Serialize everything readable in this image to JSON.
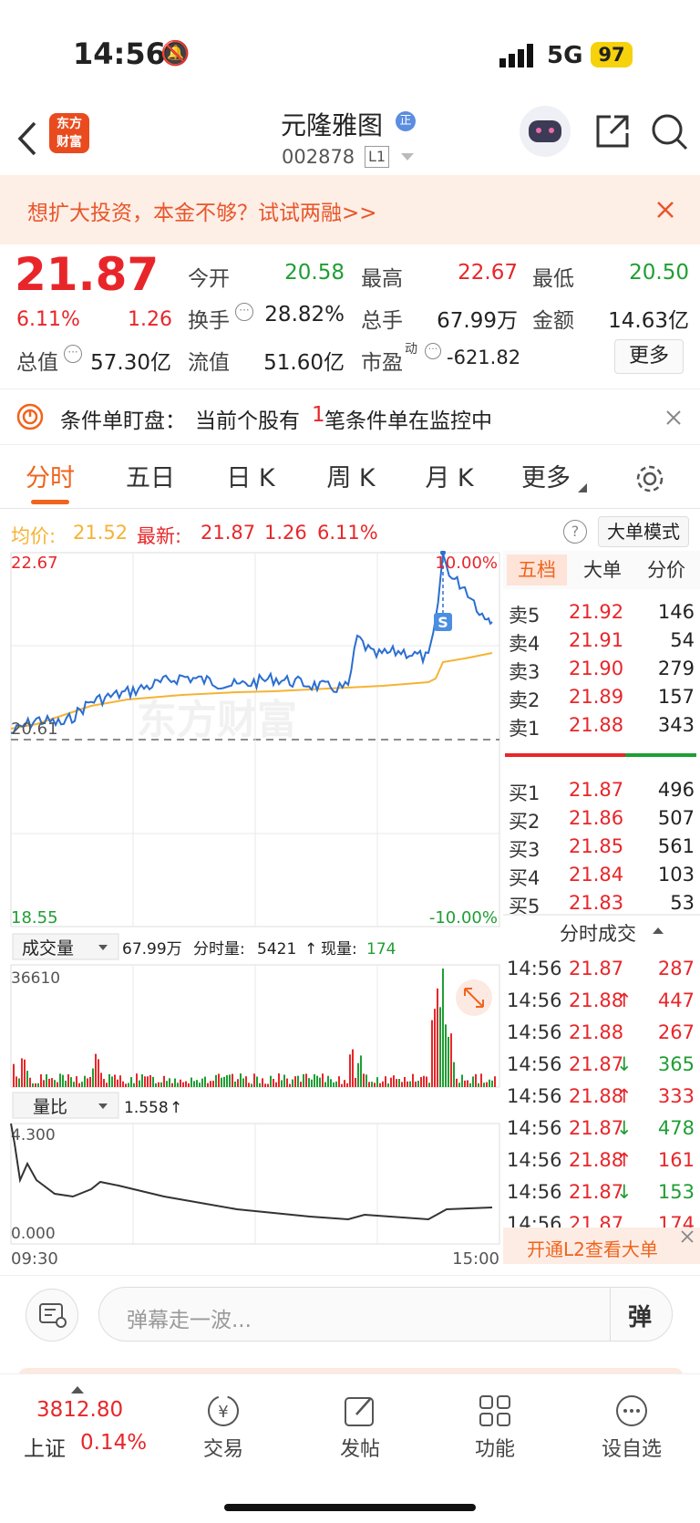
{
  "status": {
    "time": "14:56",
    "network": "5G",
    "battery": "97"
  },
  "nav": {
    "logo_line1": "东方",
    "logo_line2": "财富",
    "stock_name": "元隆雅图",
    "badge": "正",
    "code": "002878",
    "level": "L1"
  },
  "banner": {
    "text": "想扩大投资，本金不够？试试两融>>"
  },
  "quote": {
    "price": "21.87",
    "pct": "6.11%",
    "chg": "1.26",
    "open_label": "今开",
    "open": "20.58",
    "high_label": "最高",
    "high": "22.67",
    "low_label": "最低",
    "low": "20.50",
    "turnover_label": "换手",
    "turnover": "28.82%",
    "vol_label": "总手",
    "vol": "67.99万",
    "amount_label": "金额",
    "amount": "14.63亿",
    "mcap_label": "总值",
    "mcap": "57.30亿",
    "float_label": "流值",
    "float": "51.60亿",
    "pe_label": "市盈",
    "pe_sup": "动",
    "pe": "-621.82",
    "more": "更多"
  },
  "cond": {
    "label": "条件单盯盘：",
    "text_pre": "当前个股有",
    "count": "1",
    "text_post": "笔条件单在监控中"
  },
  "tabs": [
    "分时",
    "五日",
    "日 K",
    "周 K",
    "月 K",
    "更多"
  ],
  "avgline": {
    "avg_label": "均价:",
    "avg": "21.52",
    "latest_label": "最新:",
    "latest": "21.87",
    "chg": "1.26",
    "pct": "6.11%",
    "mode_btn": "大单模式"
  },
  "chart": {
    "y_top": "22.67",
    "y_mid": "20.61",
    "y_bot": "18.55",
    "pct_top": "10.00%",
    "pct_bot": "-10.00%",
    "watermark": "东方财富",
    "s_marker": "S",
    "vol_selector": "成交量",
    "vol_total": "67.99万",
    "vol_seg_label": "分时量:",
    "vol_seg": "5421",
    "vol_now_label": "现量:",
    "vol_now": "174",
    "vol_max": "36610",
    "ratio_selector": "量比",
    "ratio_value": "1.558",
    "ratio_max": "4.300",
    "ratio_min": "0.000",
    "t_start": "09:30",
    "t_end": "15:00"
  },
  "book": {
    "tabs": [
      "五档",
      "大单",
      "分价"
    ],
    "asks": [
      {
        "label": "卖5",
        "price": "21.92",
        "vol": "146"
      },
      {
        "label": "卖4",
        "price": "21.91",
        "vol": "54"
      },
      {
        "label": "卖3",
        "price": "21.90",
        "vol": "279"
      },
      {
        "label": "卖2",
        "price": "21.89",
        "vol": "157"
      },
      {
        "label": "卖1",
        "price": "21.88",
        "vol": "343"
      }
    ],
    "bids": [
      {
        "label": "买1",
        "price": "21.87",
        "vol": "496"
      },
      {
        "label": "买2",
        "price": "21.86",
        "vol": "507"
      },
      {
        "label": "买3",
        "price": "21.85",
        "vol": "561"
      },
      {
        "label": "买4",
        "price": "21.84",
        "vol": "103"
      },
      {
        "label": "买5",
        "price": "21.83",
        "vol": "53"
      }
    ],
    "trades_title": "分时成交",
    "trades": [
      {
        "time": "14:56",
        "price": "21.87",
        "arrow": "",
        "vol": "287"
      },
      {
        "time": "14:56",
        "price": "21.88",
        "arrow": "↑",
        "vol": "447"
      },
      {
        "time": "14:56",
        "price": "21.88",
        "arrow": "",
        "vol": "267"
      },
      {
        "time": "14:56",
        "price": "21.87",
        "arrow": "↓",
        "vol": "365"
      },
      {
        "time": "14:56",
        "price": "21.88",
        "arrow": "↑",
        "vol": "333"
      },
      {
        "time": "14:56",
        "price": "21.87",
        "arrow": "↓",
        "vol": "478"
      },
      {
        "time": "14:56",
        "price": "21.88",
        "arrow": "↑",
        "vol": "161"
      },
      {
        "time": "14:56",
        "price": "21.87",
        "arrow": "↓",
        "vol": "153"
      },
      {
        "time": "14:56",
        "price": "21.87",
        "arrow": "",
        "vol": "174"
      }
    ],
    "l2_text": "开通L2查看大单"
  },
  "danmu": {
    "placeholder": "弹幕走一波...",
    "send": "弹"
  },
  "bottom": {
    "index_value": "3812.80",
    "index_name": "上证",
    "index_pct": "0.14%",
    "items": [
      "交易",
      "发帖",
      "功能",
      "设自选"
    ]
  },
  "colors": {
    "up": "#e8262a",
    "down": "#1f9e34",
    "accent": "#f0641e",
    "price_line": "#2b6ed0",
    "avg_line": "#f5b333"
  }
}
